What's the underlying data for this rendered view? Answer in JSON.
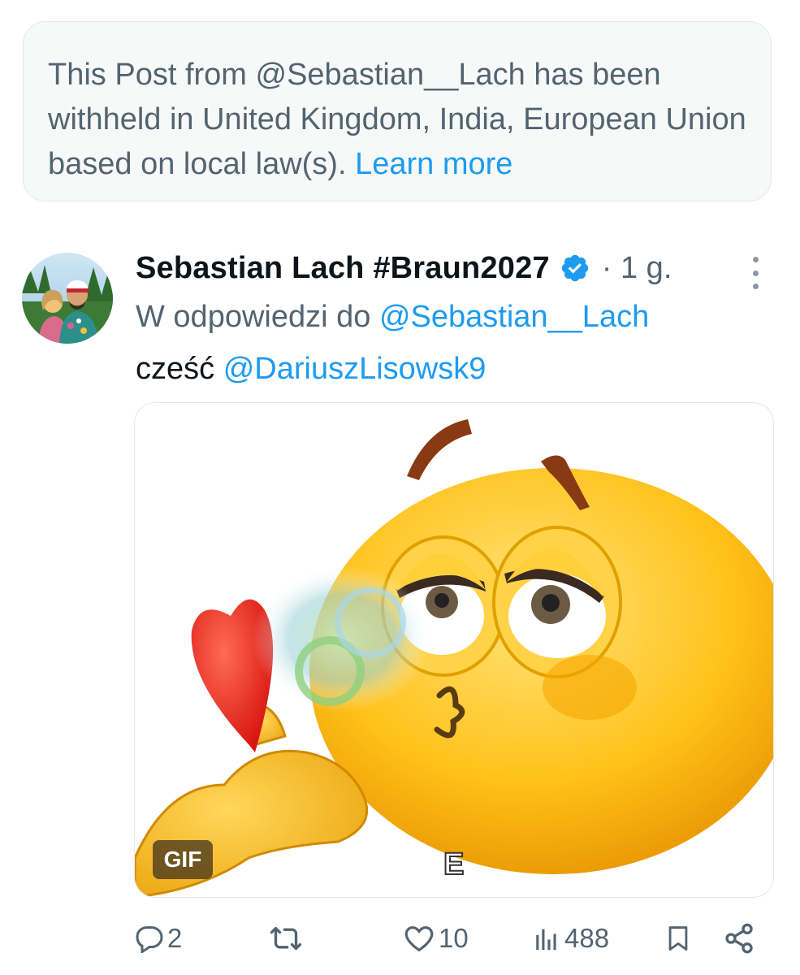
{
  "notice": {
    "text": "This Post from @Sebastian__Lach has been withheld in United Kingdom, India, European Union based on local law(s).",
    "link": "Learn more"
  },
  "post": {
    "author_name": "Sebastian Lach #Braun2027",
    "time": "· 1 g.",
    "reply_prefix": "W odpowiedzi do",
    "reply_handle": "@Sebastian__Lach",
    "text": "cześć",
    "mention": "@DariuszLisowsk9",
    "media": {
      "badge": "GIF",
      "overlay_letter": "E"
    }
  },
  "actions": {
    "replies": "2",
    "retweets": "",
    "likes": "10",
    "views": "488"
  },
  "colors": {
    "accent": "#1d9bf0",
    "secondary_text": "#536471",
    "notice_bg": "#f7f9f9",
    "emoji_yellow": "#f7b500",
    "heart_red": "#e8221b"
  },
  "icons": [
    "verified-badge-icon",
    "more-options-icon",
    "reply-icon",
    "retweet-icon",
    "like-icon",
    "views-icon",
    "bookmark-icon",
    "share-icon"
  ]
}
